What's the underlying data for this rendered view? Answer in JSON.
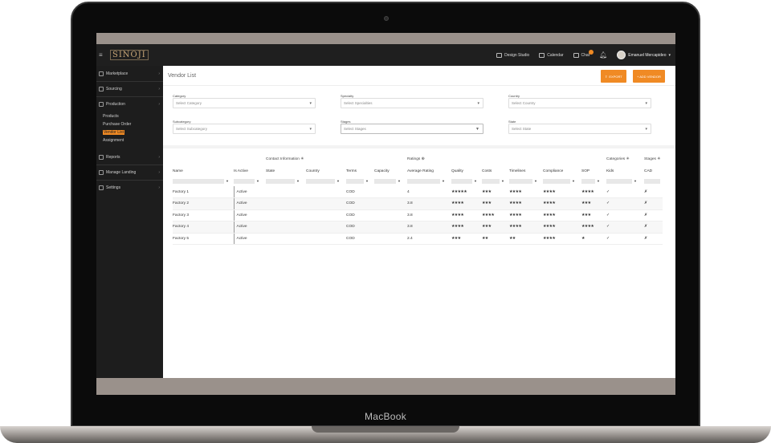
{
  "device": {
    "label": "MacBook"
  },
  "app": {
    "logo": "SINOJI",
    "topnav": [
      {
        "label": "Design Studio",
        "icon": "design-studio-icon"
      },
      {
        "label": "Calendar",
        "icon": "calendar-icon"
      },
      {
        "label": "Chat",
        "icon": "chat-icon"
      }
    ],
    "user": {
      "name": "Emanuel Mercapideo"
    },
    "accent_color": "#f08a24"
  },
  "sidebar": {
    "items": [
      {
        "label": "Marketplace",
        "icon": "marketplace-icon"
      },
      {
        "label": "Sourcing",
        "icon": "sourcing-icon"
      },
      {
        "label": "Production",
        "icon": "production-icon"
      }
    ],
    "production_sub": [
      "Products",
      "Purchase Order",
      "Vendor List",
      "Assignment"
    ],
    "bottom_items": [
      {
        "label": "Reports",
        "icon": "reports-icon"
      },
      {
        "label": "Manage Landing",
        "icon": "manage-landing-icon"
      },
      {
        "label": "Settings",
        "icon": "settings-icon"
      }
    ]
  },
  "page": {
    "title": "Vendor List",
    "export_label": "EXPORT",
    "add_vendor_label": "+ ADD VENDOR"
  },
  "filters": {
    "category": {
      "label": "Category",
      "placeholder": "Select Category"
    },
    "specialty": {
      "label": "Specialty",
      "placeholder": "Select Specialties"
    },
    "country": {
      "label": "Country",
      "placeholder": "Select Country"
    },
    "subcategory": {
      "label": "Subcategory",
      "placeholder": "Select Subcategory"
    },
    "stages": {
      "label": "Stages",
      "placeholder": "Select Stages"
    },
    "state": {
      "label": "State",
      "placeholder": "Select State"
    }
  },
  "table": {
    "groups": {
      "contact": "Contact Information ✳",
      "ratings": "Ratings ⊕",
      "categories": "Categories ✳",
      "stages": "Stages ✳"
    },
    "columns": [
      "Name",
      "Is Active",
      "State",
      "Country",
      "Terms",
      "Capacity",
      "Average Rating",
      "Quality",
      "Costs",
      "Timelines",
      "Compliance",
      "SOP",
      "Kids",
      "CAD"
    ],
    "rows": [
      {
        "name": "Factory 1",
        "active": "Active",
        "terms": "COD",
        "avg": "4",
        "quality": "★★★★★",
        "costs": "★★★",
        "timelines": "★★★★",
        "compliance": "★★★★",
        "sop": "★★★★",
        "kids": "✓",
        "cad": "✗"
      },
      {
        "name": "Factory 2",
        "active": "Active",
        "terms": "COD",
        "avg": "3.8",
        "quality": "★★★★",
        "costs": "★★★",
        "timelines": "★★★★",
        "compliance": "★★★★",
        "sop": "★★★",
        "kids": "✓",
        "cad": "✗"
      },
      {
        "name": "Factory 3",
        "active": "Active",
        "terms": "COD",
        "avg": "3.8",
        "quality": "★★★★",
        "costs": "★★★★",
        "timelines": "★★★★",
        "compliance": "★★★★",
        "sop": "★★★",
        "kids": "✓",
        "cad": "✗"
      },
      {
        "name": "Factory 4",
        "active": "Active",
        "terms": "COD",
        "avg": "3.8",
        "quality": "★★★★",
        "costs": "★★★",
        "timelines": "★★★★",
        "compliance": "★★★★",
        "sop": "★★★★",
        "kids": "✓",
        "cad": "✗"
      },
      {
        "name": "Factory 5",
        "active": "Active",
        "terms": "COD",
        "avg": "2.4",
        "quality": "★★★",
        "costs": "★★",
        "timelines": "★★",
        "compliance": "★★★★",
        "sop": "★",
        "kids": "✓",
        "cad": "✗"
      }
    ]
  }
}
